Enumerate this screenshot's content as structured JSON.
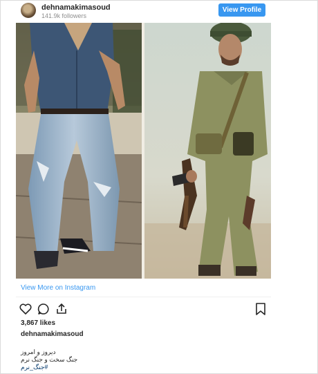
{
  "header": {
    "username": "dehnamakimasoud",
    "followers": "141.9k followers",
    "view_profile": "View Profile"
  },
  "post": {
    "view_more": "View More on Instagram",
    "likes": "3,867 likes",
    "caption_user": "dehnamakimasoud",
    "caption_lines": [
      "دیروز و امروز",
      "جنگ سخت و جنگ نرم"
    ],
    "hashtag": "#جنگ_نرم"
  },
  "icons": [
    "like-icon",
    "comment-icon",
    "share-icon",
    "bookmark-icon"
  ],
  "colors": {
    "accent": "#3897f0",
    "text": "#262626",
    "muted": "#8e8e8e",
    "border": "#dbdbdb"
  }
}
